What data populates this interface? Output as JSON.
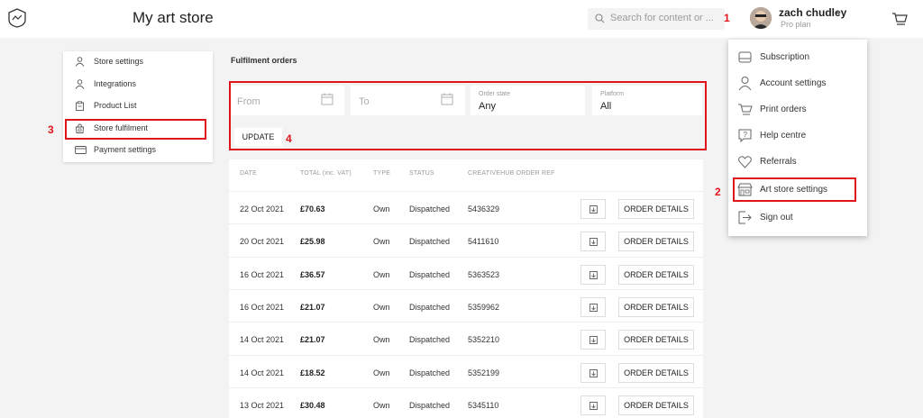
{
  "header": {
    "title": "My art store",
    "search_placeholder": "Search for content or ...",
    "user_name": "zach chudley",
    "user_plan": "Pro plan",
    "caret": "▾"
  },
  "annotations": [
    "1",
    "2",
    "3",
    "4"
  ],
  "sidebar": {
    "items": [
      {
        "label": "Store settings",
        "icon": "person-icon"
      },
      {
        "label": "Integrations",
        "icon": "person-icon"
      },
      {
        "label": "Product List",
        "icon": "clipboard-icon"
      },
      {
        "label": "Store fulfilment",
        "icon": "bag-icon"
      },
      {
        "label": "Payment settings",
        "icon": "card-icon"
      }
    ]
  },
  "main": {
    "section_title": "Fulfilment orders",
    "filters": {
      "from_placeholder": "From",
      "to_placeholder": "To",
      "order_state_label": "Order state",
      "order_state_value": "Any",
      "platform_label": "Platform",
      "platform_value": "All",
      "update_label": "UPDATE"
    },
    "table": {
      "headers": [
        "DATE",
        "TOTAL (inc. VAT)",
        "TYPE",
        "STATUS",
        "CREATIVEHUB ORDER REF"
      ],
      "order_details_label": "ORDER DETAILS",
      "rows": [
        {
          "date": "22 Oct 2021",
          "total": "£70.63",
          "type": "Own",
          "status": "Dispatched",
          "ref": "5436329"
        },
        {
          "date": "20 Oct 2021",
          "total": "£25.98",
          "type": "Own",
          "status": "Dispatched",
          "ref": "5411610"
        },
        {
          "date": "16 Oct 2021",
          "total": "£36.57",
          "type": "Own",
          "status": "Dispatched",
          "ref": "5363523"
        },
        {
          "date": "16 Oct 2021",
          "total": "£21.07",
          "type": "Own",
          "status": "Dispatched",
          "ref": "5359962"
        },
        {
          "date": "14 Oct 2021",
          "total": "£21.07",
          "type": "Own",
          "status": "Dispatched",
          "ref": "5352210"
        },
        {
          "date": "14 Oct 2021",
          "total": "£18.52",
          "type": "Own",
          "status": "Dispatched",
          "ref": "5352199"
        },
        {
          "date": "13 Oct 2021",
          "total": "£30.48",
          "type": "Own",
          "status": "Dispatched",
          "ref": "5345110"
        }
      ]
    }
  },
  "menu": {
    "items": [
      {
        "label": "Subscription",
        "icon": "subscription-icon"
      },
      {
        "label": "Account settings",
        "icon": "person-icon"
      },
      {
        "label": "Print orders",
        "icon": "cart-icon"
      },
      {
        "label": "Help centre",
        "icon": "help-icon"
      },
      {
        "label": "Referrals",
        "icon": "heart-icon"
      },
      {
        "label": "Art store settings",
        "icon": "store-icon"
      },
      {
        "label": "Sign out",
        "icon": "sign-out-icon"
      }
    ]
  },
  "colors": {
    "annotation": "#e0151b",
    "background": "#f3f3f3"
  }
}
